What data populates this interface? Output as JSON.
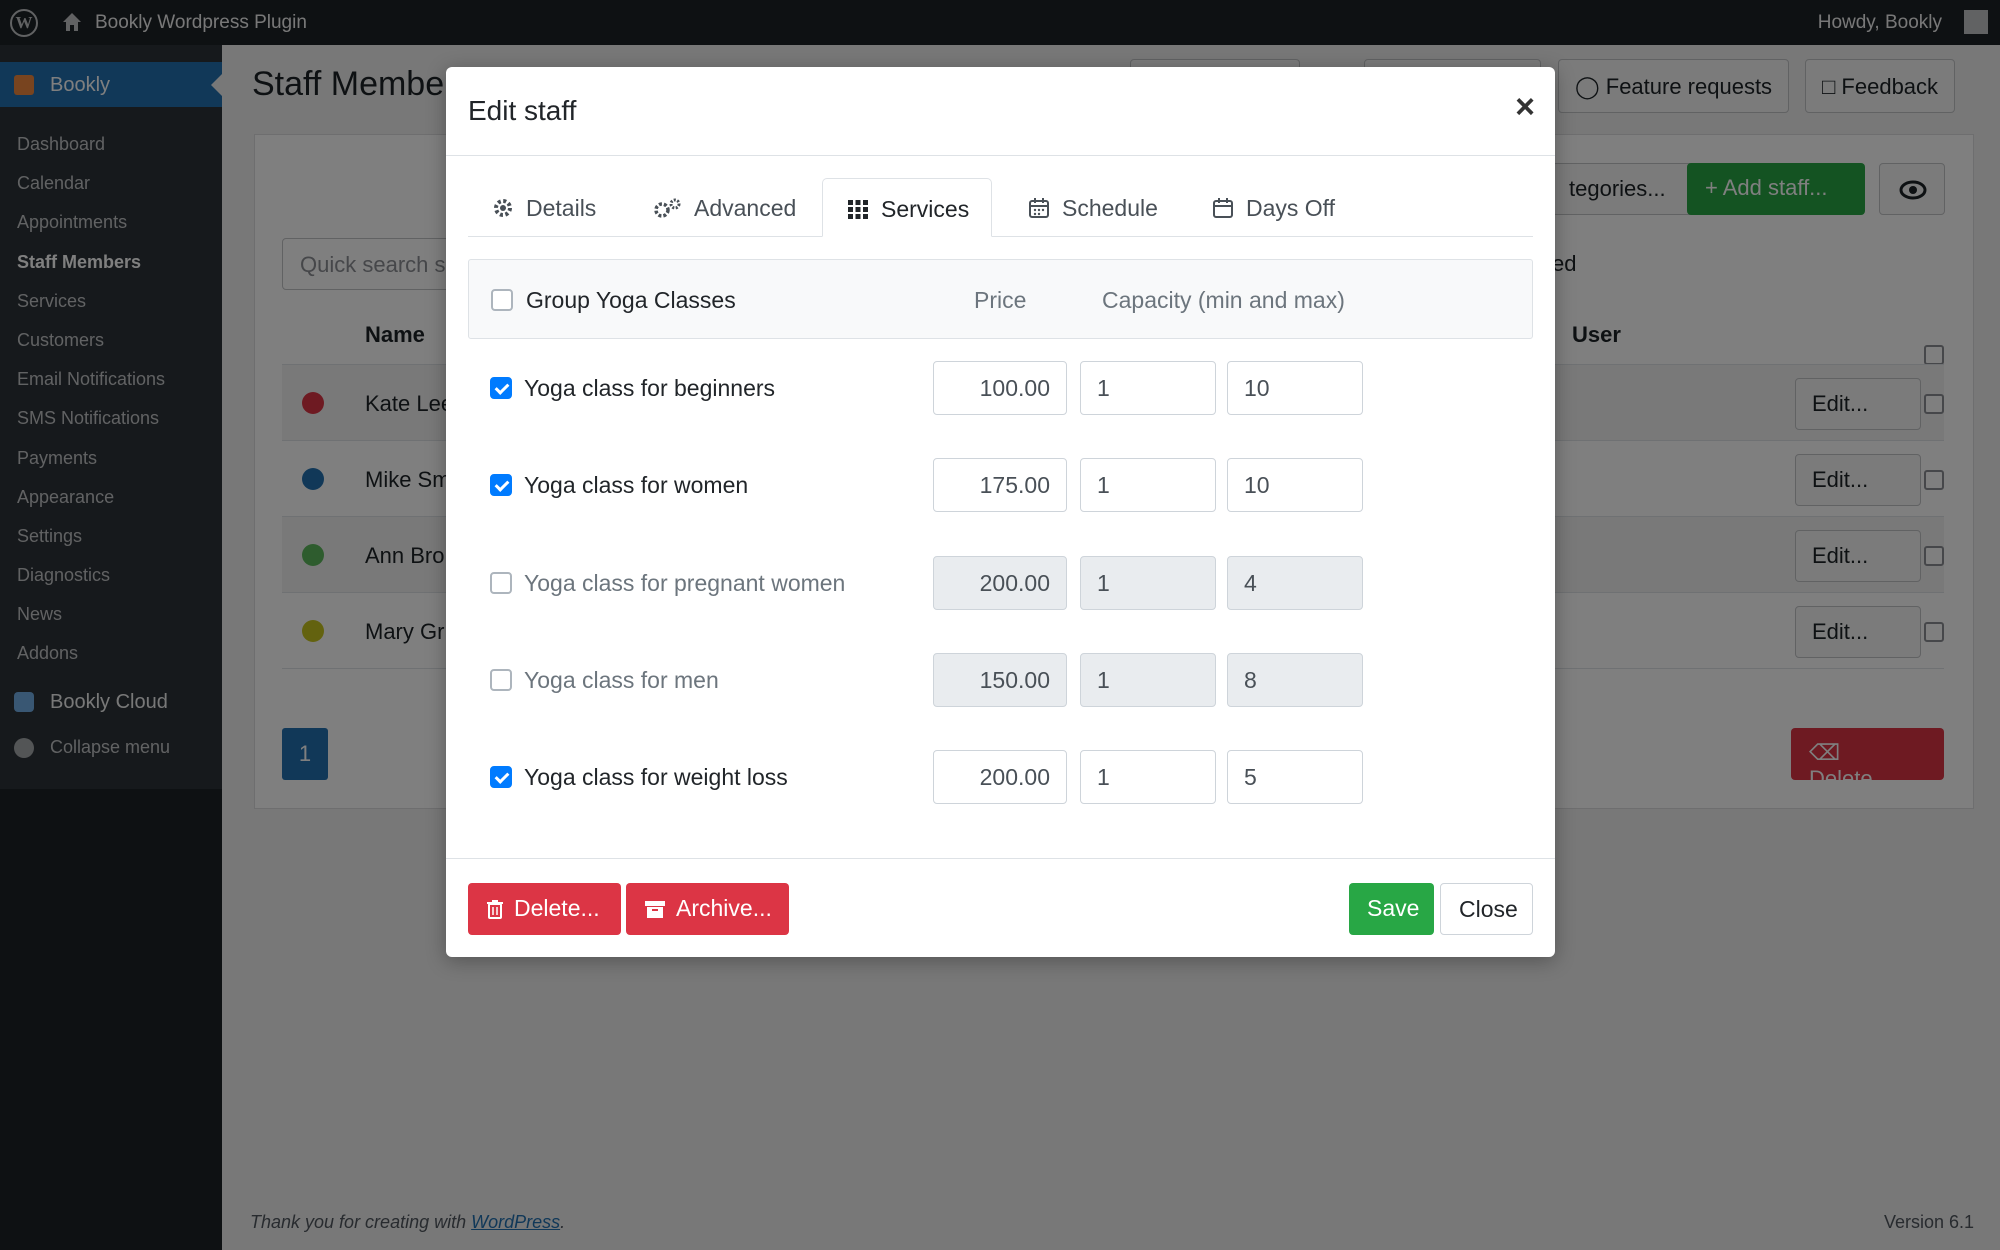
{
  "adminbar": {
    "site_name": "Bookly Wordpress Plugin",
    "howdy": "Howdy, Bookly",
    "wp_logo": "W"
  },
  "sidebar": {
    "plugin": "Bookly",
    "items": [
      {
        "label": "Dashboard"
      },
      {
        "label": "Calendar"
      },
      {
        "label": "Appointments"
      },
      {
        "label": "Staff Members",
        "current": true
      },
      {
        "label": "Services"
      },
      {
        "label": "Customers"
      },
      {
        "label": "Email Notifications"
      },
      {
        "label": "SMS Notifications"
      },
      {
        "label": "Payments"
      },
      {
        "label": "Appearance"
      },
      {
        "label": "Settings"
      },
      {
        "label": "Diagnostics"
      },
      {
        "label": "News"
      },
      {
        "label": "Addons"
      }
    ],
    "cloud": "Bookly Cloud",
    "collapse": "Collapse menu"
  },
  "page": {
    "title": "Staff Membe",
    "feature_requests": "Feature requests",
    "feedback": "Feedback",
    "categories_button": "tegories...",
    "add_staff": "Add staff...",
    "search_placeholder": "Quick search s",
    "ed_text": "ed",
    "col_name": "Name",
    "col_user": "User",
    "rows": [
      {
        "name": "Kate Lee",
        "color": "#dc3545"
      },
      {
        "name": "Mike Sm",
        "color": "#2271b1"
      },
      {
        "name": "Ann Bro",
        "color": "#5cb85c"
      },
      {
        "name": "Mary Gr",
        "color": "#c7c41e"
      }
    ],
    "edit_label": "Edit...",
    "page_number": "1",
    "delete_label": "Delete..."
  },
  "footer": {
    "thanks_prefix": "Thank you for creating with ",
    "thanks_link": "WordPress",
    "thanks_suffix": ".",
    "version": "Version 6.1"
  },
  "modal": {
    "title": "Edit staff",
    "close_symbol": "×",
    "tabs": [
      {
        "label": "Details",
        "icon": "gear-icon"
      },
      {
        "label": "Advanced",
        "icon": "gears-icon"
      },
      {
        "label": "Services",
        "icon": "grid-icon",
        "active": true
      },
      {
        "label": "Schedule",
        "icon": "calendar-icon"
      },
      {
        "label": "Days Off",
        "icon": "calendar-empty-icon"
      }
    ],
    "group": {
      "label": "Group Yoga Classes",
      "price_header": "Price",
      "capacity_header": "Capacity (min and max)",
      "checked": false
    },
    "services": [
      {
        "name": "Yoga class for beginners",
        "checked": true,
        "price": "100.00",
        "min": "1",
        "max": "10"
      },
      {
        "name": "Yoga class for women",
        "checked": true,
        "price": "175.00",
        "min": "1",
        "max": "10"
      },
      {
        "name": "Yoga class for pregnant women",
        "checked": false,
        "price": "200.00",
        "min": "1",
        "max": "4"
      },
      {
        "name": "Yoga class for men",
        "checked": false,
        "price": "150.00",
        "min": "1",
        "max": "8"
      },
      {
        "name": "Yoga class for weight loss",
        "checked": true,
        "price": "200.00",
        "min": "1",
        "max": "5"
      }
    ],
    "buttons": {
      "delete": "Delete...",
      "archive": "Archive...",
      "save": "Save",
      "close": "Close"
    }
  }
}
